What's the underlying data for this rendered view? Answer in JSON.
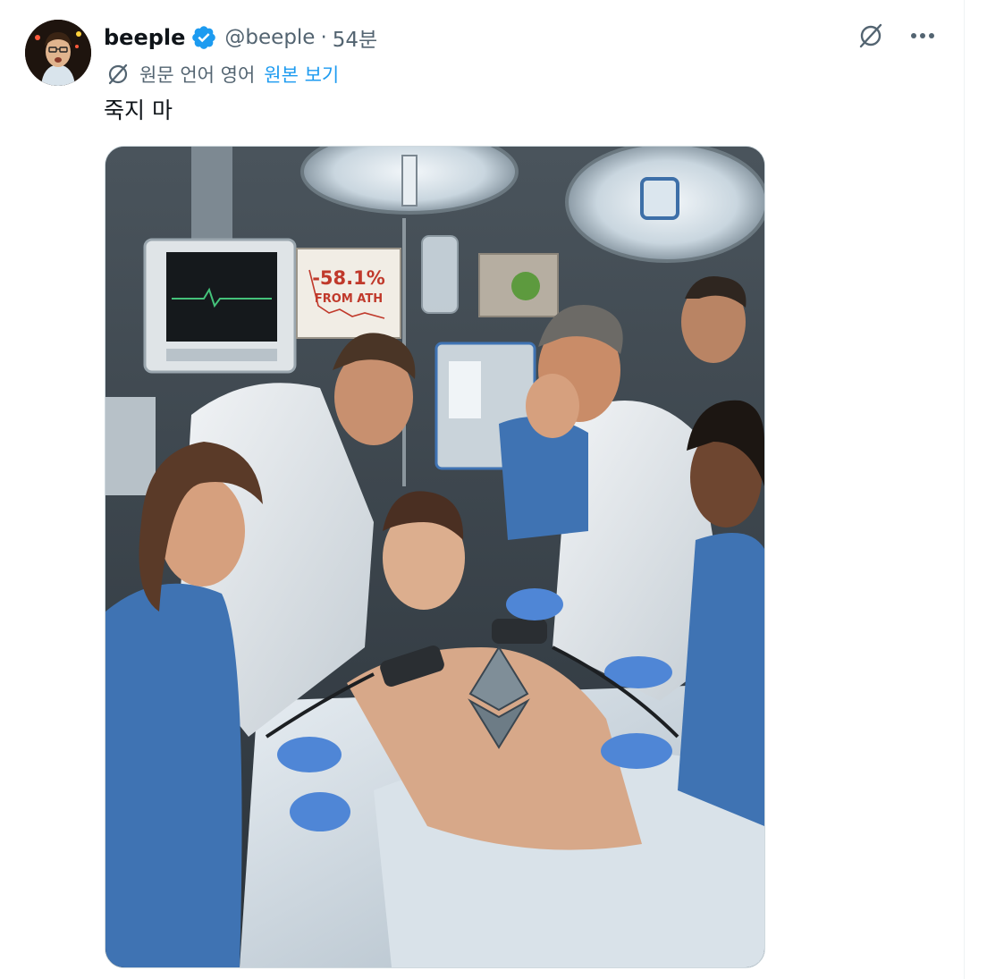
{
  "tweet": {
    "author": {
      "display_name": "beeple",
      "handle": "@beeple",
      "verified": true
    },
    "separator": "·",
    "timestamp": "54분",
    "translation": {
      "label": "원문 언어 영어",
      "show_original": "원본 보기"
    },
    "text": "죽지 마",
    "media": {
      "chart_text": "-58.1%",
      "chart_subtext": "FROM ATH"
    }
  },
  "icons": {
    "verified": "verified-badge-icon",
    "translate": "translate-icon",
    "grok": "grok-icon",
    "more": "more-icon"
  },
  "colors": {
    "link": "#1d9bf0",
    "secondary_text": "#536471",
    "primary_text": "#0f1419",
    "scrub_blue": "#3f73b3",
    "chart_red": "#c0392b"
  }
}
